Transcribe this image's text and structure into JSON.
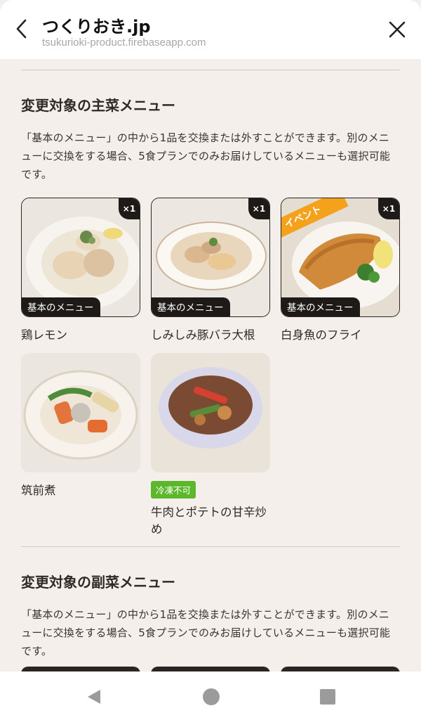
{
  "header": {
    "title": "つくりおき.jp",
    "url": "tsukurioki-product.firebaseapp.com"
  },
  "main_section": {
    "title": "変更対象の主菜メニュー",
    "description": "「基本のメニュー」の中から1品を交換または外すことができます。別のメニューに交換をする場合、5食プランでのみお届けしているメニューも選択可能です。",
    "items": [
      {
        "name": "鶏レモン",
        "count": "×1",
        "basic_label": "基本のメニュー"
      },
      {
        "name": "しみしみ豚バラ大根",
        "count": "×1",
        "basic_label": "基本のメニュー"
      },
      {
        "name": "白身魚のフライ",
        "count": "×1",
        "basic_label": "基本のメニュー",
        "ribbon": "イベント"
      },
      {
        "name": "筑前煮"
      },
      {
        "name": "牛肉とポテトの甘辛炒め",
        "tag": "冷凍不可"
      }
    ]
  },
  "side_section": {
    "title": "変更対象の副菜メニュー",
    "description": "「基本のメニュー」の中から1品を交換または外すことができます。別のメニューに交換をする場合、5食プランでのみお届けしているメニューも選択可能です。"
  },
  "colors": {
    "background": "#f4efea",
    "badge": "#1e1a18",
    "ribbon": "#f4a21c",
    "tag_green": "#5cb82a"
  },
  "icons": [
    "back-arrow-icon",
    "close-icon",
    "nav-back-icon",
    "nav-home-icon",
    "nav-recents-icon"
  ]
}
